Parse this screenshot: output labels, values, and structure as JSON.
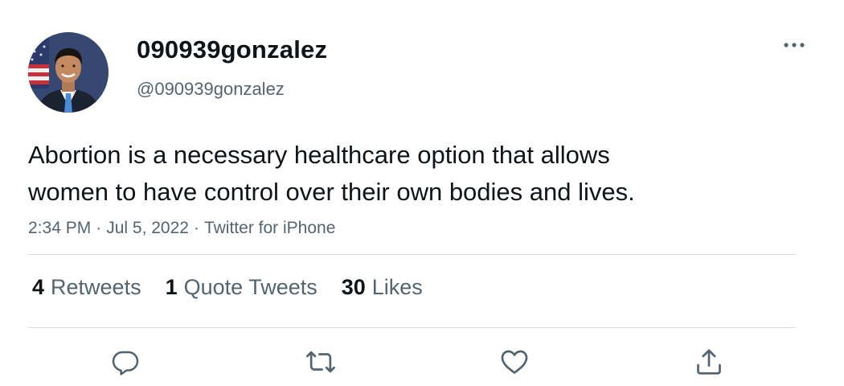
{
  "user": {
    "display_name": "090939gonzalez",
    "handle": "@090939gonzalez"
  },
  "tweet": {
    "text": "Abortion is a necessary healthcare option that allows\nwomen to have control over their own bodies and lives.",
    "time": "2:34 PM",
    "date": "Jul 5, 2022",
    "source": "Twitter for iPhone",
    "separator": "·"
  },
  "stats": {
    "retweets": {
      "count": "4",
      "label": "Retweets"
    },
    "quotes": {
      "count": "1",
      "label": "Quote Tweets"
    },
    "likes": {
      "count": "30",
      "label": "Likes"
    }
  },
  "icons": {
    "more": "more-icon",
    "reply": "reply-icon",
    "retweet": "retweet-icon",
    "like": "like-icon",
    "share": "share-icon"
  },
  "colors": {
    "text_primary": "#0f1419",
    "text_secondary": "#536471",
    "divider": "#d9dde1",
    "icon": "#536471"
  }
}
